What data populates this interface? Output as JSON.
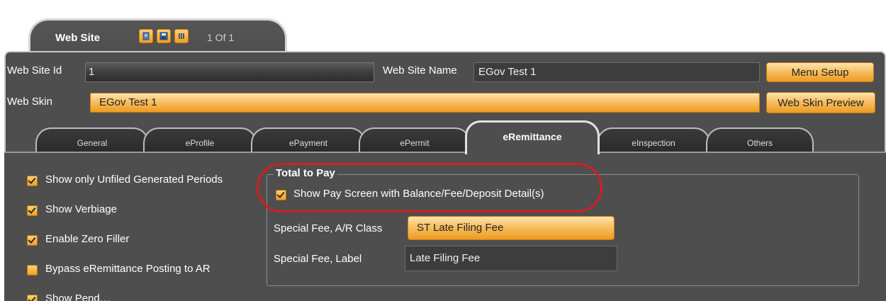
{
  "header_tab": {
    "title": "Web Site",
    "pager": "1 Of 1",
    "toolbar_icons": [
      "new-record-icon",
      "save-icon",
      "columns-icon"
    ]
  },
  "fields": {
    "web_site_id": {
      "label": "Web Site Id",
      "value": "1"
    },
    "web_site_name": {
      "label": "Web Site Name",
      "value": "EGov Test 1"
    },
    "web_skin": {
      "label": "Web Skin",
      "value": "EGov Test 1"
    }
  },
  "buttons": {
    "menu_setup": "Menu Setup",
    "web_skin_preview": "Web Skin Preview"
  },
  "tabs": [
    {
      "label": "General",
      "active": false
    },
    {
      "label": "eProfile",
      "active": false
    },
    {
      "label": "ePayment",
      "active": false
    },
    {
      "label": "ePermit",
      "active": false
    },
    {
      "label": "eRemittance",
      "active": true
    },
    {
      "label": "eInspection",
      "active": false
    },
    {
      "label": "Others",
      "active": false
    }
  ],
  "options": [
    {
      "label": "Show only Unfiled Generated Periods",
      "checked": true
    },
    {
      "label": "Show Verbiage",
      "checked": true
    },
    {
      "label": "Enable Zero Filler",
      "checked": true
    },
    {
      "label": "Bypass eRemittance Posting to AR",
      "checked": false
    },
    {
      "label": "Show Pend…",
      "checked": true
    }
  ],
  "total_to_pay": {
    "title": "Total to Pay",
    "show_pay_screen": {
      "label": "Show Pay Screen with Balance/Fee/Deposit Detail(s)",
      "checked": true
    },
    "special_fee_class": {
      "label": "Special Fee, A/R Class",
      "value": "ST Late Filing Fee"
    },
    "special_fee_label": {
      "label": "Special Fee, Label",
      "value": "Late Filing Fee"
    }
  },
  "colors": {
    "accent_orange": "#f7bf62",
    "panel_bg": "#4e4e4e",
    "highlight_red": "#d31f1f"
  }
}
